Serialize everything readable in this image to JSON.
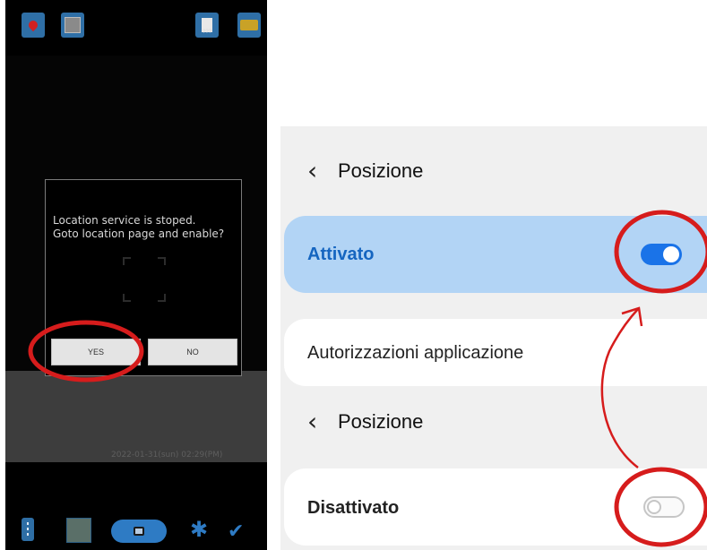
{
  "left_phone": {
    "top_icons": [
      "map-pin-icon",
      "gallery-icon",
      "document-icon",
      "tag-icon"
    ],
    "doc_icon_sub": "???",
    "dialog": {
      "line1": "Location service is stoped.",
      "line2": "Goto location page and enable?",
      "yes_label": "YES",
      "no_label": "NO"
    },
    "timestamp": "2022-01-31(sun) 02:29(PM)",
    "bottom_icons": [
      "menu-icon",
      "thumbnail-icon",
      "camera-icon",
      "gear-icon",
      "check-icon"
    ]
  },
  "right_panel": {
    "header_top": {
      "back_glyph": "‹",
      "title": "Posizione"
    },
    "toggle_on": {
      "label": "Attivato",
      "state": "on"
    },
    "permissions": {
      "label": "Autorizzazioni applicazione"
    },
    "header_bottom": {
      "back_glyph": "‹",
      "title": "Posizione"
    },
    "toggle_off": {
      "label": "Disattivato",
      "state": "off"
    }
  },
  "colors": {
    "annotation": "#d61c1c",
    "accent_blue": "#1a73e8",
    "active_card": "#b2d4f5"
  }
}
